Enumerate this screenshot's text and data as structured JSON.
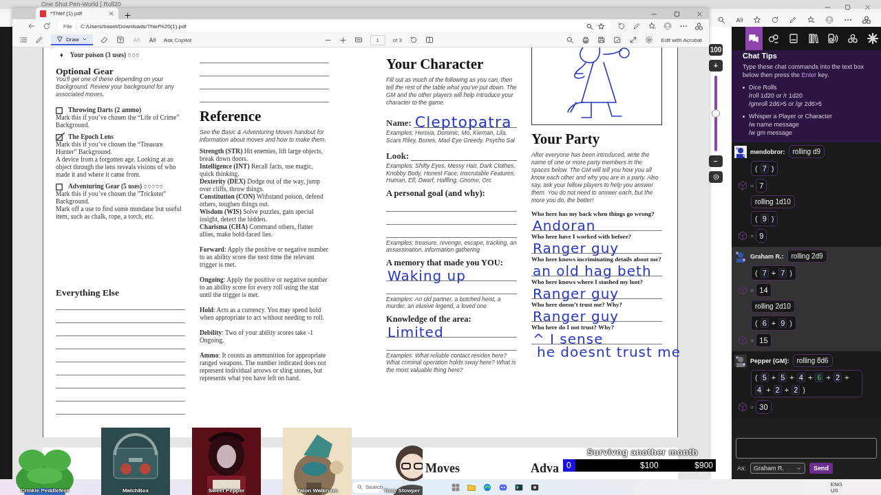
{
  "back_browser": {
    "tab": "One Shot Pen-World | Roll20"
  },
  "pdf_window": {
    "tab": {
      "title": "*Thief (1).pdf"
    },
    "address": {
      "badge": "File",
      "url": "C:/Users/baset/Downloads/Thief%20(1).pdf"
    },
    "toolbar": {
      "draw": {
        "label": "Draw",
        "selected": true
      },
      "ask": "Ask Copilot",
      "page": "1",
      "of": "of 3",
      "acrobat": "Edit with Acrobat"
    },
    "page": {
      "columns": [
        {
          "sections": [
            {
              "blocks": [
                {
                  "kind": "bullet",
                  "marker": "♦",
                  "text": "Your poison (3 uses) ○○○"
                },
                {
                  "kind": "heading",
                  "text": "Optional Gear"
                },
                {
                  "kind": "intro",
                  "text": "You'll get one of these depending on your Background. Review your background for any associated moves."
                },
                {
                  "kind": "check",
                  "title": "Throwing Darts (2 ammo)",
                  "checked": false,
                  "body": [
                    "Mark this if you’ve chosen the “Life of Crime” Background."
                  ]
                },
                {
                  "kind": "check",
                  "title": "The Epoch Lens",
                  "checked": true,
                  "body": [
                    "Mark this if you’ve chosen the “Treasure Hunter” Background.",
                    "A device from a forgotten age. Looking at an object through the lens reveals visions of who made it and where it came from."
                  ]
                },
                {
                  "kind": "check",
                  "title": "Adventuring Gear (5 uses) ○○○○○",
                  "checked": false,
                  "body": [
                    "Mark this if you’ve chosen the \"Trickster\" Background.",
                    "Mark off a use to find some mundane but useful item, such as chalk, rope, a torch, etc."
                  ]
                }
              ]
            },
            {
              "blocks": [
                {
                  "kind": "heading",
                  "text": "Everything Else"
                },
                {
                  "kind": "line"
                },
                {
                  "kind": "line"
                },
                {
                  "kind": "line"
                },
                {
                  "kind": "line"
                },
                {
                  "kind": "line"
                },
                {
                  "kind": "line"
                },
                {
                  "kind": "line"
                },
                {
                  "kind": "line"
                },
                {
                  "kind": "line"
                }
              ]
            }
          ]
        },
        {
          "sections": [
            {
              "blocks": [
                {
                  "kind": "line"
                },
                {
                  "kind": "line"
                },
                {
                  "kind": "line"
                },
                {
                  "kind": "line"
                },
                {
                  "kind": "title",
                  "text": "Reference"
                },
                {
                  "kind": "intro",
                  "text": "See the Basic & Adventuring Moves handout for information about moves and how to make them."
                },
                {
                  "kind": "term",
                  "text": "**Strength (STR)** Hit enemies, lift large objects, break down doors."
                },
                {
                  "kind": "term",
                  "text": "**Intelligence (INT)** Recall facts, use magic, quick thinking."
                },
                {
                  "kind": "term",
                  "text": "**Dexterity (DEX)**  Dodge out of the way, jump over cliffs, throw things."
                },
                {
                  "kind": "term",
                  "text": "**Constitution (CON)** Withstand poison, defend others, toughen things out."
                },
                {
                  "kind": "term",
                  "text": "**Wisdom (WIS)**  Solve puzzles, gain special insight, detect the hidden."
                },
                {
                  "kind": "term",
                  "text": "**Charisma (CHA)** Command others, flatter allies, make bold-faced lies."
                },
                {
                  "kind": "para",
                  "text": "**Forward**: Apply the positive or negative number to an ability score the next time the relevant trigger is met."
                },
                {
                  "kind": "para",
                  "text": "**Ongoing**: Apply the positive or negative number to an ability score for every roll using the stat until the trigger is met."
                },
                {
                  "kind": "para",
                  "text": "**Hold**: Acts as a currency. You may spend hold when appropriate to act without needing to roll."
                },
                {
                  "kind": "para",
                  "text": "**Debility**: Two of your ability scores take -1 Ongoing."
                },
                {
                  "kind": "para",
                  "text": "**Ammo**: It counts as ammunition for appropriate ranged weapons. The number indicated does not represent individual arrows or sling stones, but represents what you have left on hand."
                }
              ]
            }
          ]
        },
        {
          "sections": [
            {
              "blocks": [
                {
                  "kind": "title",
                  "text": "Your Character"
                },
                {
                  "kind": "intro",
                  "text": "Fill out as much of the following as you can, then tell the rest of the table what you’ve put down. The GM and the other players will help introduce your character to the game."
                },
                {
                  "kind": "field",
                  "label": "Name:",
                  "handwriting": "Cleptopatra"
                },
                {
                  "kind": "examples",
                  "text": "Examples: Herova, Dominic, Mo, Kiernan, Lila, Scars Riley, Bones, Mad-Eye Greedy, Psycho Sal"
                },
                {
                  "kind": "field",
                  "label": "Look:"
                },
                {
                  "kind": "examples",
                  "text": "Examples: Shifty Eyes, Messy Hair, Dark Clothes, Knobby Body, Honest Face, Inscrutable Features, Human, Elf, Dwarf, Halfling, Gnome, Orc"
                },
                {
                  "kind": "label",
                  "text": "A personal goal (and why):"
                },
                {
                  "kind": "line"
                },
                {
                  "kind": "line"
                },
                {
                  "kind": "line"
                },
                {
                  "kind": "examples",
                  "text": "Examples: treasure, revenge, escape, tracking, an assassination, information gathering"
                },
                {
                  "kind": "label",
                  "text": "A memory that made you YOU:"
                },
                {
                  "kind": "line",
                  "handwriting": "Waking up"
                },
                {
                  "kind": "line"
                },
                {
                  "kind": "examples",
                  "text": "Examples: An old partner, a botched heist, a murder, an elusive legend, a loved one"
                },
                {
                  "kind": "label",
                  "text": "Knowledge of the area:"
                },
                {
                  "kind": "line",
                  "handwriting": "Limited"
                },
                {
                  "kind": "line"
                },
                {
                  "kind": "examples",
                  "text": "Examples: What reliable contact resides here? What criminal operation holds sway here? What is the most valuable thing here?"
                }
              ]
            }
          ]
        },
        {
          "sections": [
            {
              "blocks": [
                {
                  "kind": "sketch"
                },
                {
                  "kind": "title",
                  "text": "Your Party"
                },
                {
                  "kind": "intro",
                  "text": "After everyone has been introduced, write the name of one or more party members in the spaces below. The GM will tell you how you all know each other and why you are in a party. Also say, ask your fellow players to help you answer them. You do not need to answer each, but the more you do, the better!"
                },
                {
                  "kind": "question",
                  "text": "Who here has my back when things go wrong?"
                },
                {
                  "kind": "line",
                  "handwriting": "Andoran"
                },
                {
                  "kind": "question",
                  "text": "Who here have I worked with before?"
                },
                {
                  "kind": "line",
                  "handwriting": "Ranger guy"
                },
                {
                  "kind": "question",
                  "text": "Who here knows incriminating details about me?"
                },
                {
                  "kind": "line",
                  "handwriting": "an old hag beth"
                },
                {
                  "kind": "question",
                  "text": "Who here knows where I stashed my loot?"
                },
                {
                  "kind": "line",
                  "handwriting": "Ranger guy"
                },
                {
                  "kind": "question",
                  "text": "Who here doesn’t trust me? Why?"
                },
                {
                  "kind": "line",
                  "handwriting": "Ranger guy"
                },
                {
                  "kind": "question",
                  "text": "Who here do I not trust? Why?"
                },
                {
                  "kind": "line",
                  "handwriting": "^ I sense"
                },
                {
                  "kind": "note",
                  "handwriting": "he doesnt trust me"
                }
              ]
            }
          ]
        }
      ]
    },
    "next_page": {
      "headings": [
        "Moves",
        "Adva"
      ]
    }
  },
  "vtt_controls": {
    "zoom": "100",
    "plus": "+",
    "minus": "−",
    "level": 0.5
  },
  "chat": {
    "tabs": [
      {
        "selected": true
      },
      {
        "selected": false
      },
      {
        "selected": false
      },
      {
        "selected": false
      },
      {
        "selected": false
      },
      {
        "selected": false
      },
      {
        "selected": false
      }
    ],
    "tips": {
      "title": "Chat Tips",
      "intro": "Type these chat commands into the text box below then press the **Enter** key.",
      "sections": [
        {
          "title": "Dice Rolls",
          "lines": [
            "/roll 1d20 or /r 1d20",
            "/gmroll 2d6>5 or /gr 2d6>5"
          ]
        },
        {
          "title": "Whisper a Player or Character",
          "lines": [
            "/w name message",
            "/w gm message"
          ]
        }
      ]
    },
    "messages": [
      {
        "speaker": "mendobror:",
        "own": false,
        "rolls": [
          {
            "label": "rolling d9",
            "tokens": [
              {
                "kind": "paren",
                "text": "("
              },
              {
                "kind": "die",
                "text": "7"
              },
              {
                "kind": "paren",
                "text": ")"
              }
            ],
            "sign": "=",
            "total": "7"
          },
          {
            "label": "rolling 1d10",
            "tokens": [
              {
                "kind": "paren",
                "text": "("
              },
              {
                "kind": "die",
                "text": "9"
              },
              {
                "kind": "paren",
                "text": ")"
              }
            ],
            "sign": "=",
            "total": "9"
          }
        ]
      },
      {
        "speaker": "Graham R.:",
        "own": true,
        "rolls": [
          {
            "label": "rolling 2d9",
            "tokens": [
              {
                "kind": "paren",
                "text": "("
              },
              {
                "kind": "die",
                "text": "7"
              },
              {
                "kind": "op",
                "text": "+"
              },
              {
                "kind": "die",
                "text": "7"
              },
              {
                "kind": "paren",
                "text": ")"
              }
            ],
            "sign": "=",
            "total": "14"
          },
          {
            "label": "rolling 2d10",
            "tokens": [
              {
                "kind": "paren",
                "text": "("
              },
              {
                "kind": "die",
                "text": "6"
              },
              {
                "kind": "op",
                "text": "+"
              },
              {
                "kind": "die",
                "text": "9"
              },
              {
                "kind": "paren",
                "text": ")"
              }
            ],
            "sign": "=",
            "total": "15"
          }
        ]
      },
      {
        "speaker": "Pepper (GM):",
        "own": false,
        "rolls": [
          {
            "label": "rolling 8d6",
            "tokens": [
              {
                "kind": "paren",
                "text": "("
              },
              {
                "kind": "die",
                "text": "5"
              },
              {
                "kind": "op",
                "text": "+"
              },
              {
                "kind": "die",
                "text": "5"
              },
              {
                "kind": "op",
                "text": "+"
              },
              {
                "kind": "die",
                "text": "4"
              },
              {
                "kind": "op",
                "text": "+"
              },
              {
                "kind": "die-max",
                "text": "6"
              },
              {
                "kind": "op",
                "text": "+"
              },
              {
                "kind": "die",
                "text": "2"
              },
              {
                "kind": "op",
                "text": "+"
              },
              {
                "kind": "die",
                "text": "4"
              },
              {
                "kind": "op",
                "text": "+"
              },
              {
                "kind": "die",
                "text": "2"
              },
              {
                "kind": "op",
                "text": "+"
              },
              {
                "kind": "die",
                "text": "2"
              },
              {
                "kind": "paren",
                "text": ")"
              }
            ],
            "sign": "=",
            "total": "30"
          }
        ]
      }
    ],
    "as_label": "As:",
    "as_value": "Graham R.",
    "send": "Send"
  },
  "overlay": {
    "viewers": [
      {
        "name": "Crinkle Peddlefeet"
      },
      {
        "name": "MatchBox"
      },
      {
        "name": "Sweet Pepper"
      },
      {
        "name": "Talon Walkruun"
      },
      {
        "name": "Tony Stowper"
      }
    ],
    "goal": {
      "title": "Survivng another month",
      "start": "0",
      "mid": "$100",
      "end": "$900",
      "level": 0.08
    }
  },
  "taskbar": {
    "search": "Search",
    "tray": [
      "ENG",
      "US"
    ]
  }
}
